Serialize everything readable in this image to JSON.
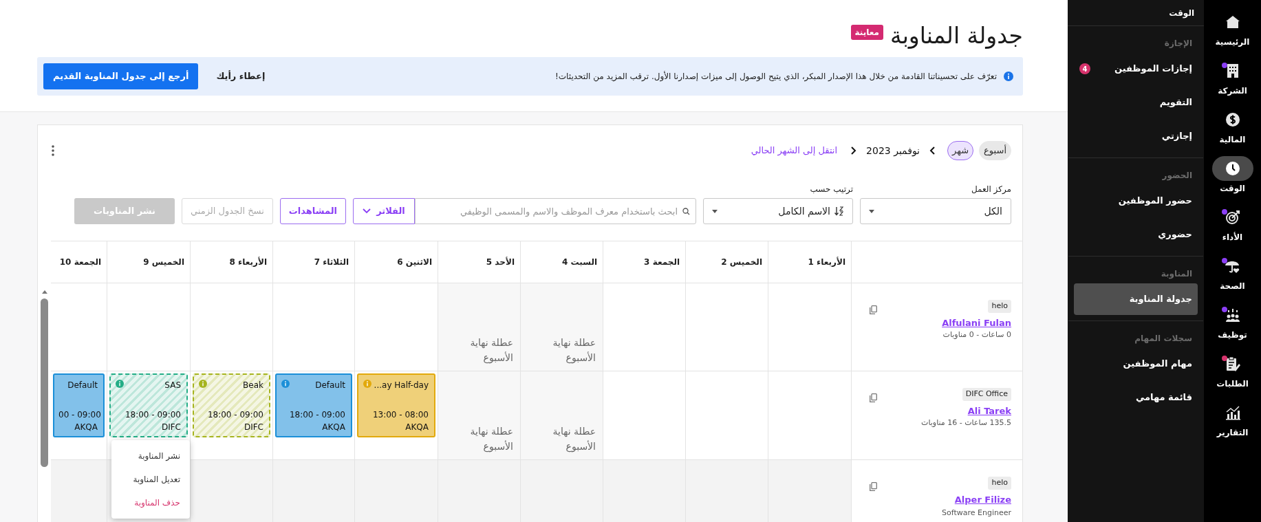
{
  "rail": [
    {
      "label": "الرئيسية",
      "selected": false
    },
    {
      "label": "الشركة",
      "selected": false,
      "color": "#8b3ff5"
    },
    {
      "label": "المالية",
      "selected": false
    },
    {
      "label": "الوقت",
      "selected": true
    },
    {
      "label": "الأداء",
      "selected": false,
      "color": "#8b3ff5"
    },
    {
      "label": "الصحة",
      "selected": false,
      "color": "#8b3ff5"
    },
    {
      "label": "توظيف",
      "selected": false,
      "color": "#8b3ff5"
    },
    {
      "label": "الطلبات",
      "selected": false,
      "color": "#d6336c"
    },
    {
      "label": "التقارير",
      "selected": false
    }
  ],
  "panel": {
    "title": "الوقت",
    "sections": [
      {
        "heading": "الإجازة",
        "items": [
          {
            "label": "إجازات الموظفين",
            "selected": false,
            "badge": "4"
          },
          {
            "label": "التقويم",
            "selected": false
          },
          {
            "label": "إجازتي",
            "selected": false
          }
        ]
      },
      {
        "heading": "الحضور",
        "items": [
          {
            "label": "حضور الموظفين",
            "selected": false
          },
          {
            "label": "حضوري",
            "selected": false
          }
        ]
      },
      {
        "heading": "المناوبة",
        "items": [
          {
            "label": "جدولة المناوبة",
            "selected": true
          }
        ]
      },
      {
        "heading": "سجلات المهام",
        "items": [
          {
            "label": "مهام الموظفين",
            "selected": false
          },
          {
            "label": "قائمة مهامي",
            "selected": false
          }
        ]
      }
    ]
  },
  "header": {
    "title": "جدولة المناوبة",
    "badge": "معاينة"
  },
  "banner": {
    "text": "تعرّف على تحسيناتنا القادمة من خلال هذا الإصدار المبكر، الذي يتيح الوصول إلى ميزات إصدارنا الأول. ترقب المزيد من التحديثات!",
    "feedback": "إعطاء رأيك",
    "back": "أرجع إلى جدول المناوبة القديم"
  },
  "toolbar": {
    "views": [
      {
        "label": "أسبوع",
        "selected": false
      },
      {
        "label": "شهر",
        "selected": true
      }
    ],
    "period": "نوفمبر 2023",
    "today_link": "انتقل إلى الشهر الحالي"
  },
  "filters": {
    "work_center": {
      "label": "مركز العمل",
      "value": "الكل"
    },
    "sort": {
      "label": "ترتيب حسب",
      "value": "الاسم الكامل"
    },
    "search": {
      "placeholder": "ابحث باستخدام معرف الموظف والاسم والمسمى الوظيفي"
    },
    "buttons": [
      {
        "label": "الفلاتر",
        "kind": "filter",
        "disabled": false
      },
      {
        "label": "المشاهدات",
        "kind": "outline",
        "disabled": false
      },
      {
        "label": "نسخ الجدول الزمني",
        "kind": "outline",
        "disabled": true
      },
      {
        "label": "نشر المناوبات",
        "kind": "solid",
        "disabled": true
      }
    ]
  },
  "grid": {
    "columns": [
      {
        "label": "الأربعاء 1"
      },
      {
        "label": "الخميس 2"
      },
      {
        "label": "الجمعة 3"
      },
      {
        "label": "السبت 4"
      },
      {
        "label": "الأحد 5"
      },
      {
        "label": "الاثنين 6"
      },
      {
        "label": "الثلاثاء 7"
      },
      {
        "label": "الأربعاء 8"
      },
      {
        "label": "الخميس 9"
      },
      {
        "label": "الجمعة 10"
      }
    ],
    "rows": [
      {
        "tag": "helo",
        "name": "Alfulani Fulan",
        "summary": "0 ساعات - 0 مناوبات",
        "greyed": false,
        "cells": [
          {
            "kind": "empty"
          },
          {
            "kind": "empty"
          },
          {
            "kind": "empty"
          },
          {
            "kind": "weekend",
            "text": "عطلة نهاية الأسبوع"
          },
          {
            "kind": "weekend",
            "text": "عطلة نهاية الأسبوع"
          },
          {
            "kind": "empty"
          },
          {
            "kind": "empty"
          },
          {
            "kind": "empty"
          },
          {
            "kind": "empty"
          },
          {
            "kind": "empty"
          }
        ]
      },
      {
        "tag": "DIFC Office",
        "name": "Ali Tarek",
        "summary": "135.5 ساعات - 16 مناوبات",
        "greyed": false,
        "cells": [
          {
            "kind": "empty"
          },
          {
            "kind": "empty"
          },
          {
            "kind": "empty"
          },
          {
            "kind": "weekend",
            "text": "عطلة نهاية الأسبوع"
          },
          {
            "kind": "weekend",
            "text": "عطلة نهاية الأسبوع"
          },
          {
            "kind": "shift",
            "published": true,
            "color": "#e2a90c",
            "info_icon": true,
            "title": "...ay Half-day",
            "time": "13:00 - 08:00",
            "location": "AKQA"
          },
          {
            "kind": "shift",
            "published": true,
            "color": "#1b8fd8",
            "info_icon": true,
            "title": "Default",
            "time": "18:00 - 09:00",
            "location": "AKQA"
          },
          {
            "kind": "shift",
            "published": false,
            "color": "#a6b41e",
            "info_icon": true,
            "title": "Beak",
            "time": "18:00 - 09:00",
            "location": "DIFC"
          },
          {
            "kind": "shift",
            "published": false,
            "color": "#23ad86",
            "info_icon": true,
            "title": "SAS",
            "time": "18:00 - 09:00",
            "location": "DIFC",
            "menu": [
              {
                "label": "نشر المناوبة",
                "kind": "normal"
              },
              {
                "label": "تعديل المناوبة",
                "kind": "normal"
              },
              {
                "label": "حذف المناوبة",
                "kind": "danger"
              }
            ]
          },
          {
            "kind": "shift",
            "published": true,
            "color": "#1b8fd8",
            "info_icon": false,
            "title": "Default",
            "time": "00 - 09:00",
            "location": "AKQA"
          }
        ]
      },
      {
        "tag": "helo",
        "name": "Alper Filize",
        "summary": "Software Engineer",
        "greyed": true,
        "cells": [
          {
            "kind": "empty"
          },
          {
            "kind": "empty"
          },
          {
            "kind": "empty"
          },
          {
            "kind": "empty"
          },
          {
            "kind": "empty"
          },
          {
            "kind": "empty"
          },
          {
            "kind": "empty"
          },
          {
            "kind": "empty"
          },
          {
            "kind": "empty"
          },
          {
            "kind": "empty"
          }
        ]
      }
    ]
  }
}
